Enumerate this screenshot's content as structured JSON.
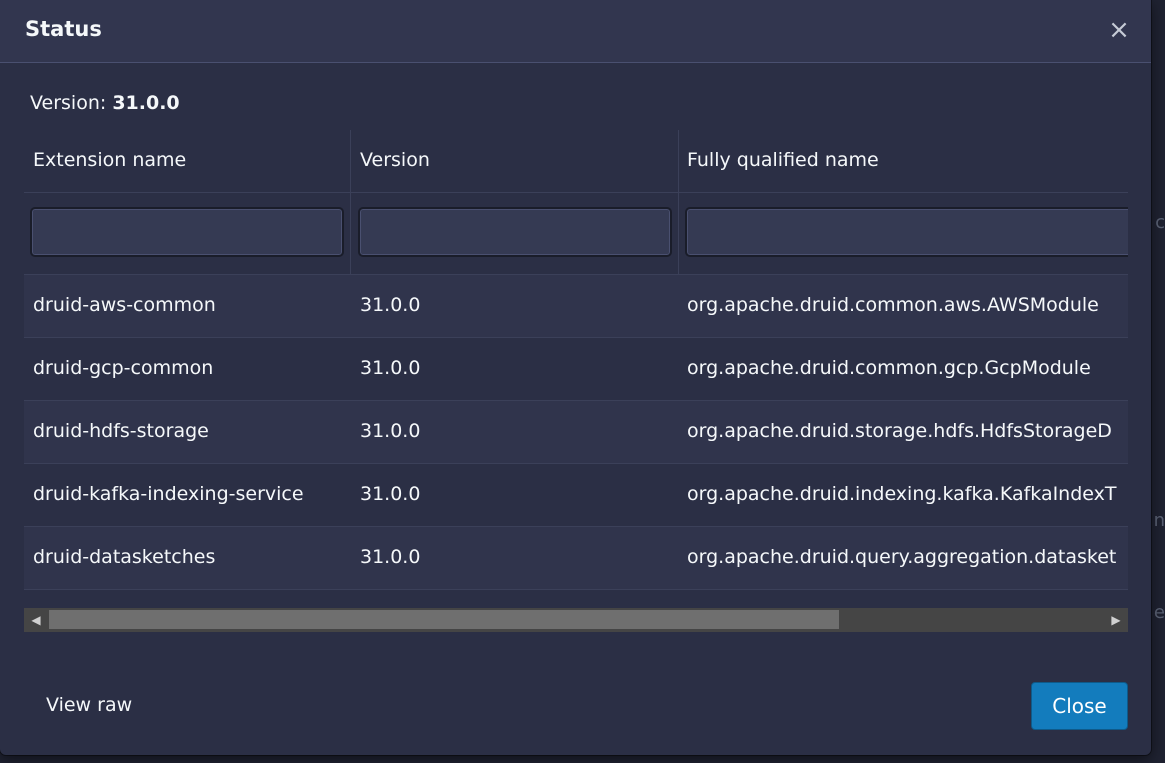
{
  "dialog": {
    "title": "Status",
    "close_icon": "×",
    "version_label": "Version:",
    "version_value": "31.0.0"
  },
  "table": {
    "columns": [
      "Extension name",
      "Version",
      "Fully qualified name"
    ],
    "rows": [
      [
        "druid-aws-common",
        "31.0.0",
        "org.apache.druid.common.aws.AWSModule"
      ],
      [
        "druid-gcp-common",
        "31.0.0",
        "org.apache.druid.common.gcp.GcpModule"
      ],
      [
        "druid-hdfs-storage",
        "31.0.0",
        "org.apache.druid.storage.hdfs.HdfsStorageD"
      ],
      [
        "druid-kafka-indexing-service",
        "31.0.0",
        "org.apache.druid.indexing.kafka.KafkaIndexT"
      ],
      [
        "druid-datasketches",
        "31.0.0",
        "org.apache.druid.query.aggregation.datasket"
      ]
    ]
  },
  "scrollbar": {
    "left_arrow": "◀",
    "right_arrow": "▶"
  },
  "footer": {
    "view_raw_label": "View raw",
    "close_label": "Close"
  },
  "colors": {
    "dialog_bg": "#2b2f45",
    "header_bg": "#32364f",
    "primary_button": "#137cbd"
  }
}
